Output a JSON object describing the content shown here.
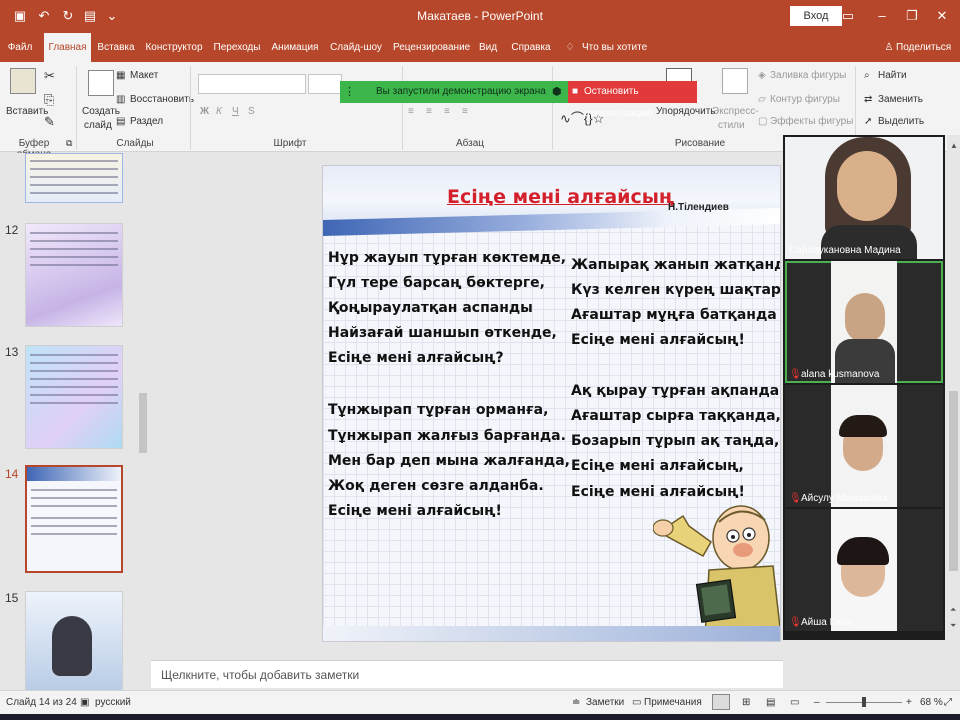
{
  "app": {
    "title": "Макатаев - PowerPoint",
    "signin_label": "Вход",
    "share_label": "Поделиться",
    "tell_me_placeholder": "Что вы хотите сделать?"
  },
  "tabs": [
    "Файл",
    "Главная",
    "Вставка",
    "Конструктор",
    "Переходы",
    "Анимация",
    "Слайд-шоу",
    "Рецензирование",
    "Вид",
    "Справка"
  ],
  "active_tab": "Главная",
  "ribbon": {
    "clipboard": {
      "paste": "Вставить",
      "label": "Буфер обмена"
    },
    "slides": {
      "create": "Создать",
      "create2": "слайд",
      "layout": "Макет",
      "reset": "Восстановить",
      "section": "Раздел",
      "label": "Слайды"
    },
    "font": {
      "label": "Шрифт",
      "bold": "Ж",
      "italic": "К",
      "underline": "Ч",
      "strike": "S"
    },
    "paragraph": {
      "label": "Абзац"
    },
    "drawing": {
      "label": "Рисование",
      "arrange": "Упорядочить",
      "express1": "Экспресс-",
      "express2": "стили",
      "fill": "Заливка фигуры",
      "outline": "Контур фигуры",
      "effects": "Эффекты фигуры"
    },
    "editing": {
      "find": "Найти",
      "replace": "Заменить",
      "select": "Выделить"
    }
  },
  "share_banner": {
    "text": "Вы запустили демонстрацию экрана",
    "stop": "Остановить демонстрацию"
  },
  "thumbnails": [
    {
      "number": "12"
    },
    {
      "number": "13"
    },
    {
      "number": "14"
    },
    {
      "number": "15"
    }
  ],
  "slide": {
    "title": "Есіңе мені алғайсың",
    "author": "Н.Тілендиев",
    "left_column": [
      "Нұр жауып тұрған көктемде,",
      "Гүл тере барсаң бөктерге,",
      "Қоңыраулатқан аспанды",
      "Найзағай шаншып өткенде,",
      "Есіңе мені алғайсың?",
      "Тұнжырап тұрған орманға,",
      "Тұнжырап жалғыз барғанда.",
      "Мен бар деп мына жалғанда,",
      "Жоқ деген сөзге алданба.",
      "Есіңе мені алғайсың!"
    ],
    "right_column": [
      "Жапырақ жанып жатқанда,",
      "Күз келген күрең шақтарда,",
      "Ағаштар мұңға батқанда",
      "Есіңе мені алғайсың!",
      "Ақ қырау тұрған ақпанда,",
      "Ағаштар сырға таққанда,",
      "Бозарып тұрып ақ таңда,",
      "Есіңе мені алғайсың,",
      "Есіңе мені алғайсың!"
    ]
  },
  "notes_placeholder": "Щелкните, чтобы добавить заметки",
  "statusbar": {
    "slide_info": "Слайд 14 из 24",
    "language": "русский",
    "notes": "Заметки",
    "comments": "Примечания",
    "zoom": "68 %"
  },
  "participants": [
    {
      "name": "Сайлаукановна Мадина",
      "muted": false,
      "active": false
    },
    {
      "name": "alana kusmanova",
      "muted": true,
      "active": true
    },
    {
      "name": "Айсулу Мамашева",
      "muted": true,
      "active": false
    },
    {
      "name": "Айша Гали",
      "muted": true,
      "active": false
    }
  ],
  "colors": {
    "accent": "#b7472a",
    "share_green": "#3cb54a",
    "stop_red": "#e23a3a",
    "title_red": "#d3202a"
  }
}
